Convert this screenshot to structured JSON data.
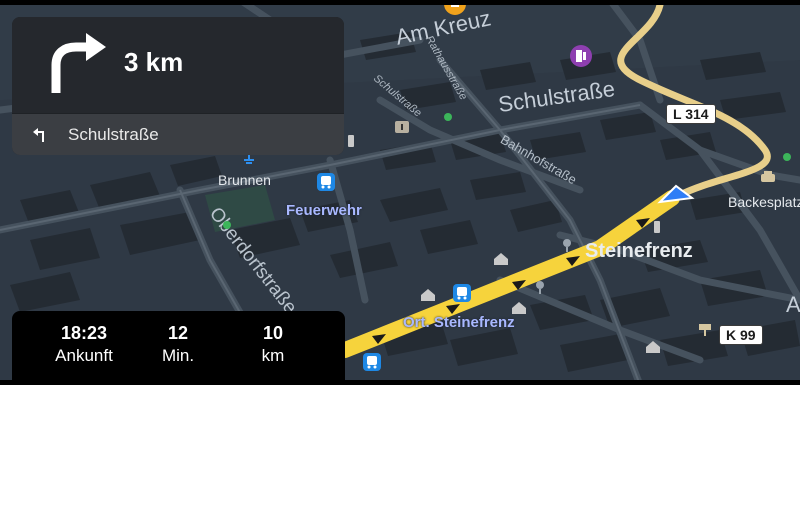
{
  "map": {
    "streets": {
      "am_kreuz": "Am Kreuz",
      "schulstrasse": "Schulstraße",
      "schulstrasse_small": "Schulstraße",
      "bahnhofstrasse": "Bahnhofstraße",
      "oberdorfstrasse": "Oberdorfstraße",
      "rathausstrasse_small": "Rathausstraße",
      "backesplatz": "Backesplatz"
    },
    "places": {
      "steinefrenz": "Steinefrenz",
      "brunnen": "Brunnen"
    },
    "pois": {
      "feuerwehr": "Feuerwehr",
      "ort_steinefrenz": "Ort. Steinefrenz"
    },
    "road_shields": {
      "l314": "L 314",
      "k99": "K 99"
    },
    "edge_letter": "A",
    "colors": {
      "map_bg": "#2f3945",
      "route": "#f6d33c",
      "route_arrow": "#1a1a1a",
      "inactive_route": "#e8cf8a",
      "poi_text": "#a9b8ff",
      "bus_icon": "#1e88e5",
      "position_marker": "#2f7df6"
    }
  },
  "maneuver": {
    "icon": "turn-right-arrow-icon",
    "distance": "3 km",
    "next_icon": "turn-left-small-icon",
    "next_street": "Schulstraße"
  },
  "eta": {
    "arrival_value": "18:23",
    "arrival_label": "Ankunft",
    "duration_value": "12",
    "duration_label": "Min.",
    "distance_value": "10",
    "distance_label": "km"
  }
}
